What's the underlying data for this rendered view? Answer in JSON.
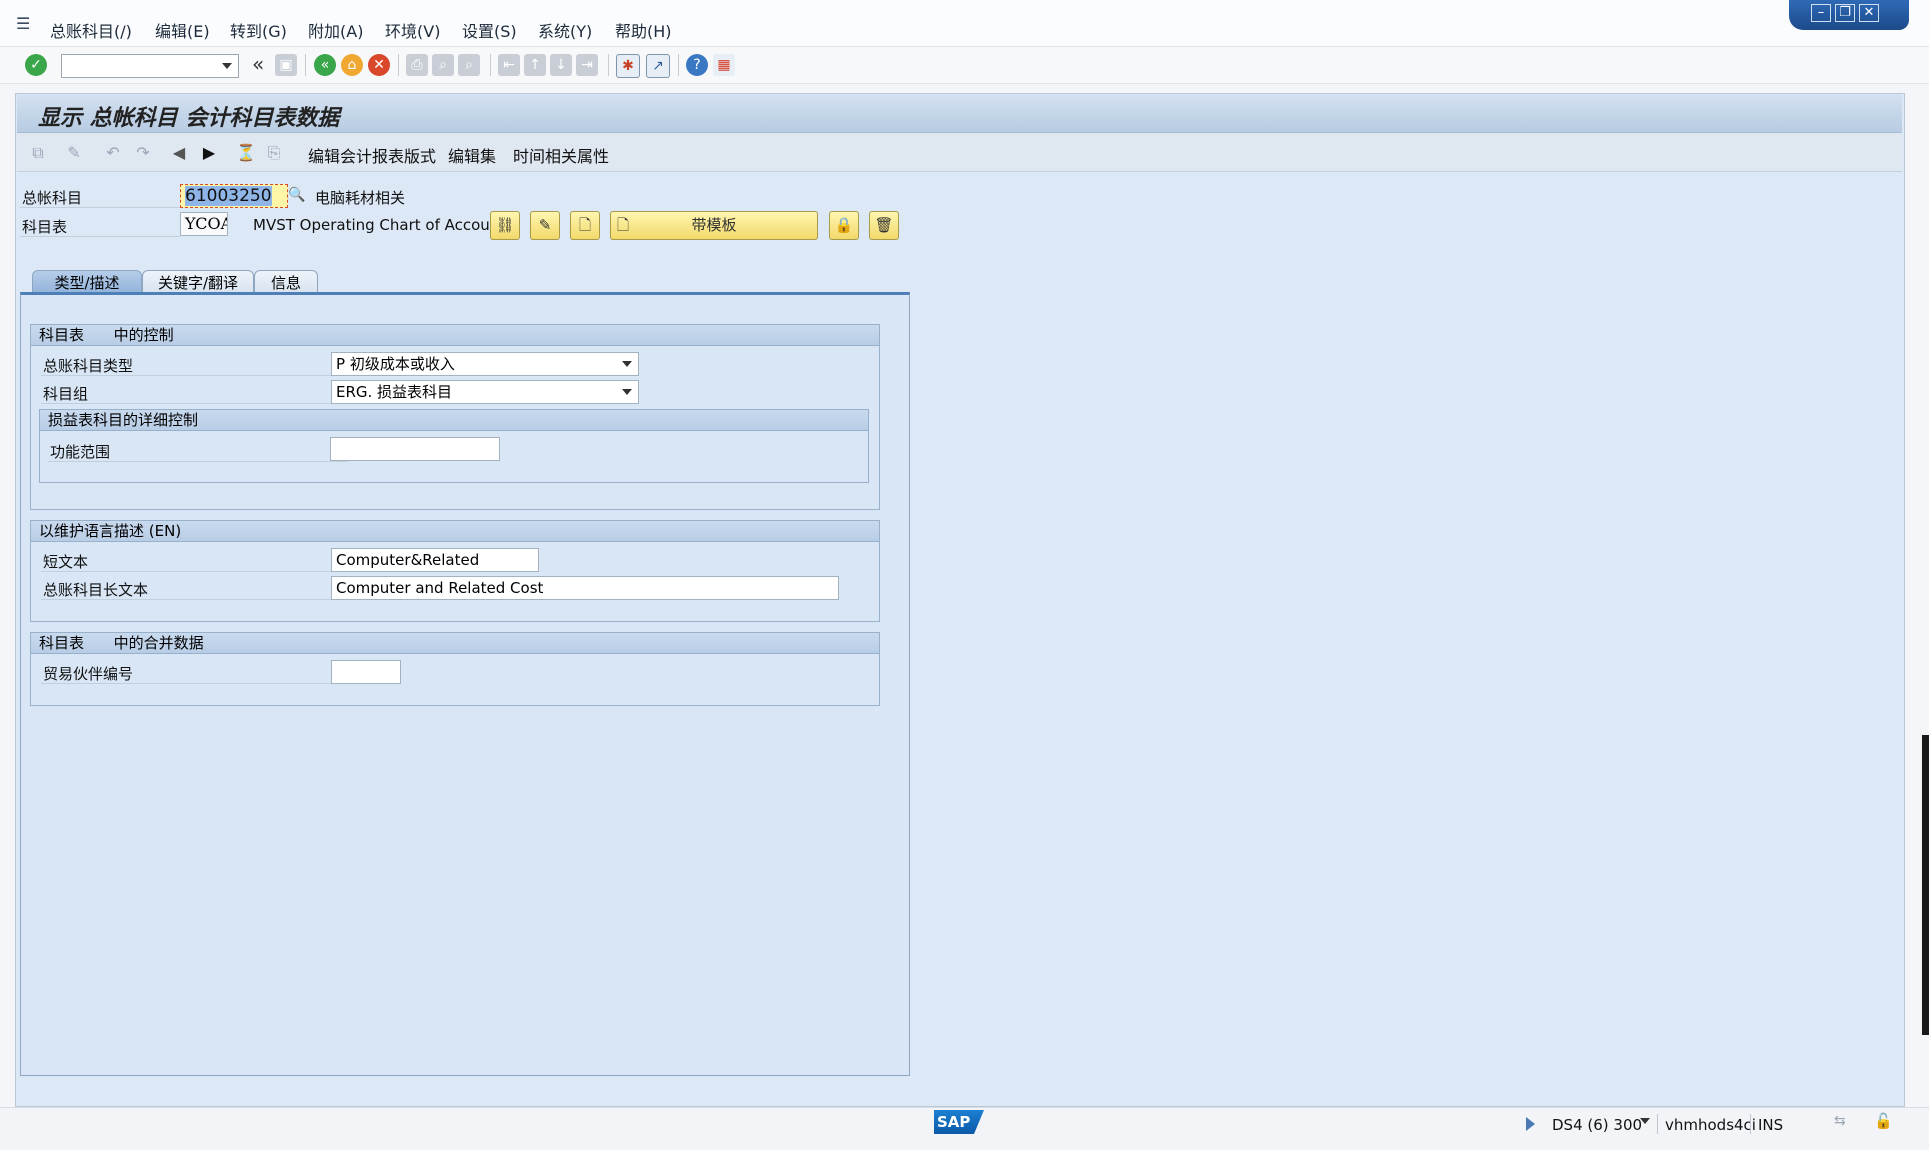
{
  "menu": {
    "items": [
      "总账科目(/)",
      "编辑(E)",
      "转到(G)",
      "附加(A)",
      "环境(V)",
      "设置(S)",
      "系统(Y)",
      "帮助(H)"
    ]
  },
  "screen": {
    "title": "显示 总帐科目 会计科目表数据"
  },
  "app_toolbar": {
    "btn_edit_fs_version": "编辑会计报表版式",
    "btn_edit_set": "编辑集",
    "btn_time_dependent": "时间相关属性"
  },
  "header": {
    "gl_account_label": "总帐科目",
    "gl_account_value": "61003250",
    "gl_account_desc": "电脑耗材相关",
    "coa_label": "科目表",
    "coa_value": "YCOA",
    "coa_desc": "MVST Operating Chart of Accou..",
    "with_template_label": "带模板"
  },
  "tabs": [
    "类型/描述",
    "关键字/翻译",
    "信息"
  ],
  "group_coa_control": {
    "title_part1": "科目表",
    "title_part2": "中的控制",
    "account_type_label": "总账科目类型",
    "account_type_value": "P 初级成本或收入",
    "account_group_label": "科目组",
    "account_group_value": "ERG. 损益表科目",
    "sub_title": "损益表科目的详细控制",
    "functional_area_label": "功能范围",
    "functional_area_value": ""
  },
  "group_description": {
    "title": "以维护语言描述 (EN)",
    "short_text_label": "短文本",
    "short_text_value": "Computer&Related",
    "long_text_label": "总账科目长文本",
    "long_text_value": "Computer and Related Cost"
  },
  "group_consolidation": {
    "title_part1": "科目表",
    "title_part2": "中的合并数据",
    "trading_partner_label": "贸易伙伴编号",
    "trading_partner_value": ""
  },
  "status": {
    "system": "DS4 (6) 300",
    "server": "vhmhods4ci",
    "mode": "INS",
    "logo": "SAP"
  },
  "colors": {
    "accent_blue": "#4f7fb7",
    "button_yellow": "#f2d96a",
    "panel_bg": "#d8e6f5"
  }
}
